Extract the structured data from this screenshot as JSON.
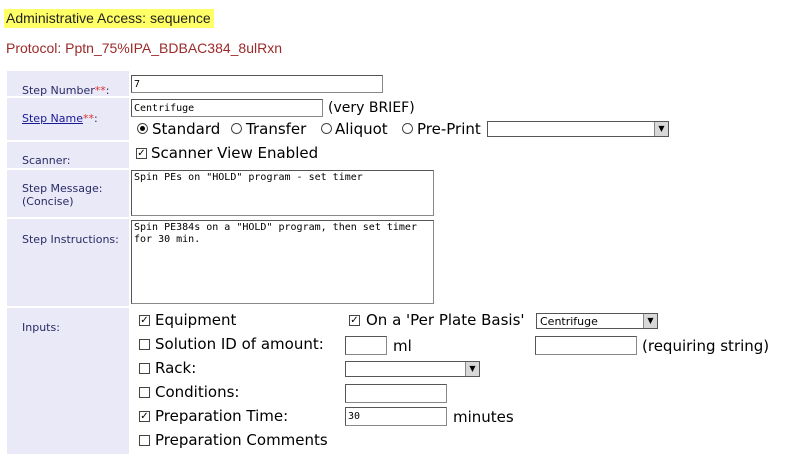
{
  "header": {
    "title": "Administrative Access: sequence",
    "protocol": "Protocol: Pptn_75%IPA_BDBAC384_8ulRxn"
  },
  "form": {
    "step_number": {
      "label": "Step Number",
      "required_mark": "**",
      "suffix": ":",
      "value": "7"
    },
    "step_name": {
      "label": "Step Name",
      "required_mark": "**",
      "suffix": ":",
      "value": "Centrifuge",
      "hint": "(very BRIEF)",
      "types": [
        {
          "label": "Standard",
          "selected": true
        },
        {
          "label": "Transfer",
          "selected": false
        },
        {
          "label": "Aliquot",
          "selected": false
        },
        {
          "label": "Pre-Print",
          "selected": false
        }
      ],
      "preprint_select": ""
    },
    "scanner": {
      "label": "Scanner:",
      "option": "Scanner View Enabled",
      "checked": true
    },
    "step_message": {
      "label_line1": "Step Message:",
      "label_line2": "(Concise)",
      "value": "Spin PEs on \"HOLD\" program - set timer"
    },
    "step_instructions": {
      "label": "Step Instructions:",
      "value": "Spin PE384s on a \"HOLD\" program, then set timer for 30 min."
    },
    "inputs": {
      "label": "Inputs:",
      "equipment": {
        "label": "Equipment",
        "checked": true
      },
      "per_plate": {
        "label": "On a 'Per Plate Basis'",
        "checked": true,
        "select_value": "Centrifuge"
      },
      "solution": {
        "label": "Solution ID of amount:",
        "checked": false,
        "amount": "",
        "unit": "ml",
        "string_value": "",
        "requiring": "(requiring string)"
      },
      "rack": {
        "label": "Rack:",
        "checked": false,
        "select_value": ""
      },
      "conditions": {
        "label": "Conditions:",
        "checked": false,
        "value": ""
      },
      "prep_time": {
        "label": "Preparation Time:",
        "checked": true,
        "value": "30",
        "unit": "minutes"
      },
      "prep_comments": {
        "label": "Preparation Comments",
        "checked": false
      }
    }
  }
}
